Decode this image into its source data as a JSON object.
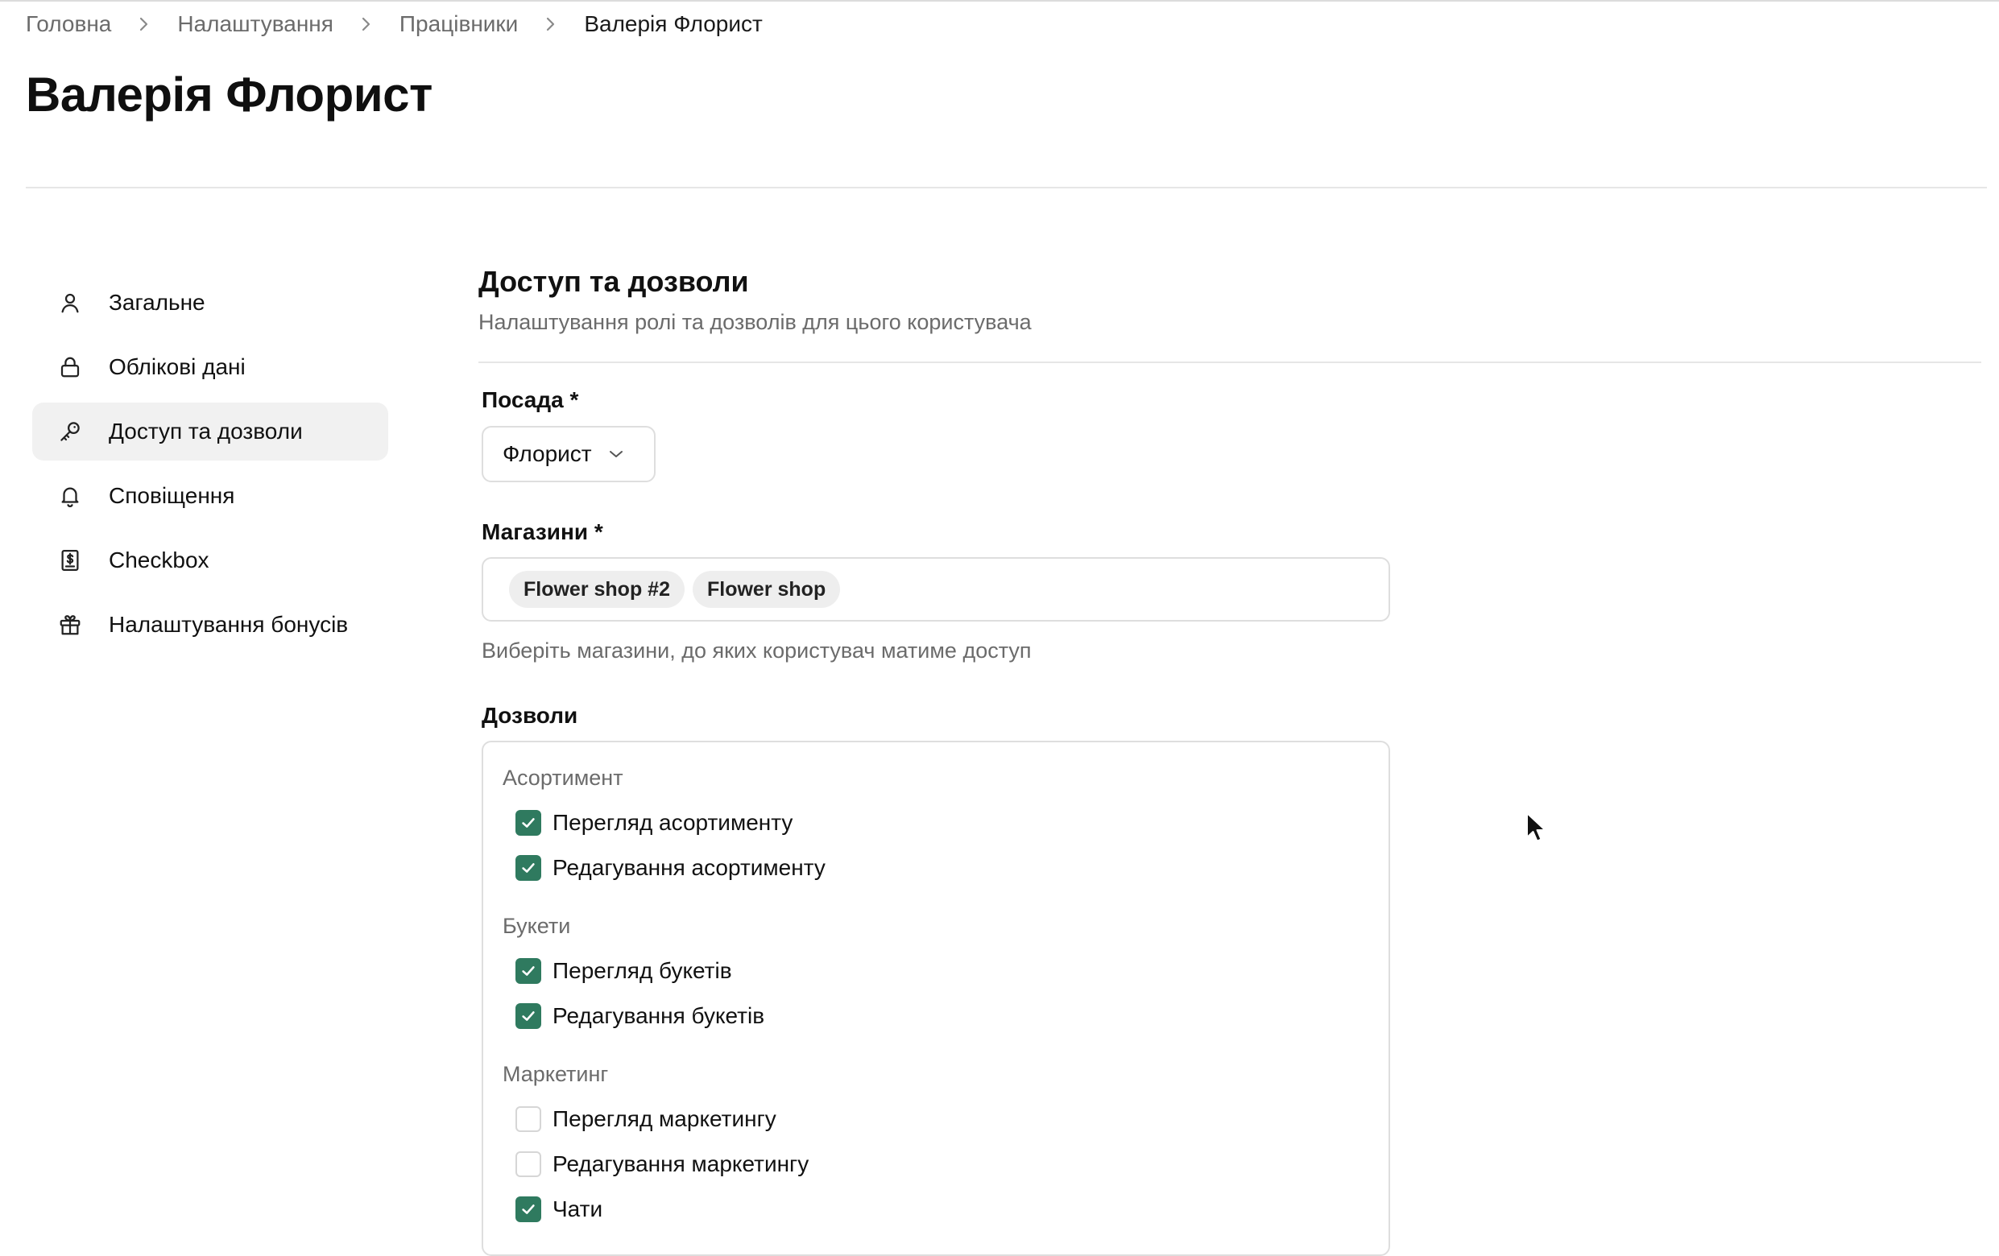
{
  "breadcrumb": {
    "items": [
      "Головна",
      "Налаштування",
      "Працівники"
    ],
    "current": "Валерія Флорист"
  },
  "page": {
    "title": "Валерія Флорист"
  },
  "sidebar": {
    "items": [
      {
        "label": "Загальне",
        "icon": "user-icon"
      },
      {
        "label": "Облікові дані",
        "icon": "lock-icon"
      },
      {
        "label": "Доступ та дозволи",
        "icon": "key-icon",
        "active": true
      },
      {
        "label": "Сповіщення",
        "icon": "bell-icon"
      },
      {
        "label": "Checkbox",
        "icon": "receipt-icon"
      },
      {
        "label": "Налаштування бонусів",
        "icon": "gift-icon"
      }
    ]
  },
  "section": {
    "title": "Доступ та дозволи",
    "subtitle": "Налаштування ролі та дозволів для цього користувача"
  },
  "position": {
    "label": "Посада *",
    "value": "Флорист"
  },
  "stores": {
    "label": "Магазини *",
    "selected": [
      "Flower shop #2",
      "Flower shop"
    ],
    "hint": "Виберіть магазини, до яких користувач матиме доступ"
  },
  "permissions": {
    "label": "Дозволи",
    "groups": [
      {
        "title": "Асортимент",
        "items": [
          {
            "label": "Перегляд асортименту",
            "checked": true
          },
          {
            "label": "Редагування асортименту",
            "checked": true
          }
        ]
      },
      {
        "title": "Букети",
        "items": [
          {
            "label": "Перегляд букетів",
            "checked": true
          },
          {
            "label": "Редагування букетів",
            "checked": true
          }
        ]
      },
      {
        "title": "Маркетинг",
        "items": [
          {
            "label": "Перегляд маркетингу",
            "checked": false
          },
          {
            "label": "Редагування маркетингу",
            "checked": false
          },
          {
            "label": "Чати",
            "checked": true
          }
        ]
      }
    ]
  },
  "colors": {
    "accent": "#2f7a5f",
    "muted_text": "#6b6b6b",
    "active_bg": "#f1f1f1",
    "border": "#dedede"
  }
}
